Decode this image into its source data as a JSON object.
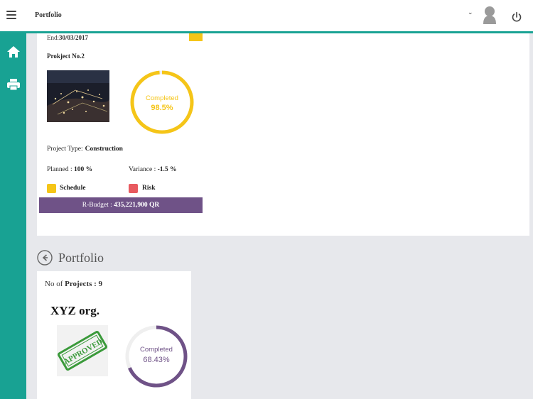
{
  "header": {
    "title": "Portfolio"
  },
  "project_card": {
    "end_label": "End:",
    "end_date": "30/03/2017",
    "name": "Prokject No.2",
    "completion": {
      "label": "Completed",
      "value": "98.5%",
      "fraction": 0.985,
      "color": "#f5c518"
    },
    "type_label": "Project Type:",
    "type_value": "Construction",
    "planned_label": "Planned :",
    "planned_value": "100 %",
    "variance_label": "Variance :",
    "variance_value": "-1.5 %",
    "legend": [
      {
        "label": "Schedule",
        "color": "#f5c518"
      },
      {
        "label": "Risk",
        "color": "#e85a5f"
      }
    ],
    "budget_label": "R-Budget :",
    "budget_value": "435,221,900 QR"
  },
  "portfolio_section": {
    "title": "Portfolio",
    "projects_prefix": "No of",
    "projects_label": "Projects :",
    "projects_count": "9",
    "org_name": "XYZ org.",
    "stamp_text": "APPROVED",
    "completion": {
      "label": "Completed",
      "value": "68.43%",
      "fraction": 0.6843,
      "color": "#6f5287"
    }
  },
  "colors": {
    "accent": "#18a293",
    "budget_bar": "#6f5287",
    "background": "#e7e8ec"
  },
  "icons": {
    "menu": "hamburger-icon",
    "dropdown": "chevron-down-icon",
    "user": "avatar-icon",
    "power": "power-icon",
    "home": "home-icon",
    "print": "printer-icon",
    "back": "back-arrow-icon"
  }
}
